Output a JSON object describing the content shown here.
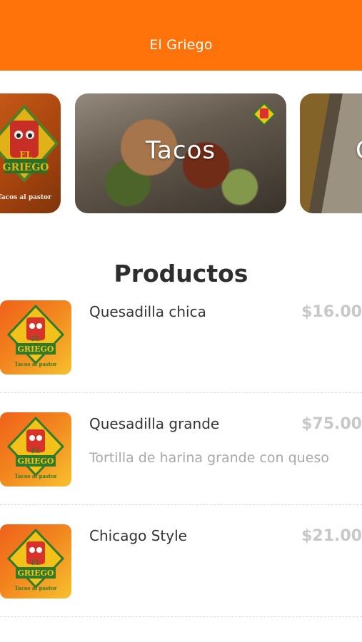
{
  "header": {
    "title": "El Griego"
  },
  "categories": [
    {
      "label": "",
      "logo_text_1": "EL",
      "logo_text_2": "GRIEGO",
      "logo_text_3": "Tacos al pastor"
    },
    {
      "label": "Tacos"
    },
    {
      "label": "C"
    }
  ],
  "section": {
    "title": "Productos"
  },
  "products": [
    {
      "name": "Quesadilla chica",
      "price": "$16.00",
      "description": ""
    },
    {
      "name": "Quesadilla grande",
      "price": "$75.00",
      "description": "Tortilla de harina grande con queso"
    },
    {
      "name": "Chicago Style",
      "price": "$21.00",
      "description": ""
    }
  ],
  "logo": {
    "line1": "EL",
    "line2": "GRIEGO",
    "line3": "Tacos al pastor"
  },
  "colors": {
    "accent": "#ff730a",
    "title": "#2e2e2e",
    "price": "#c8c8c8",
    "desc": "#a9a9a9"
  }
}
